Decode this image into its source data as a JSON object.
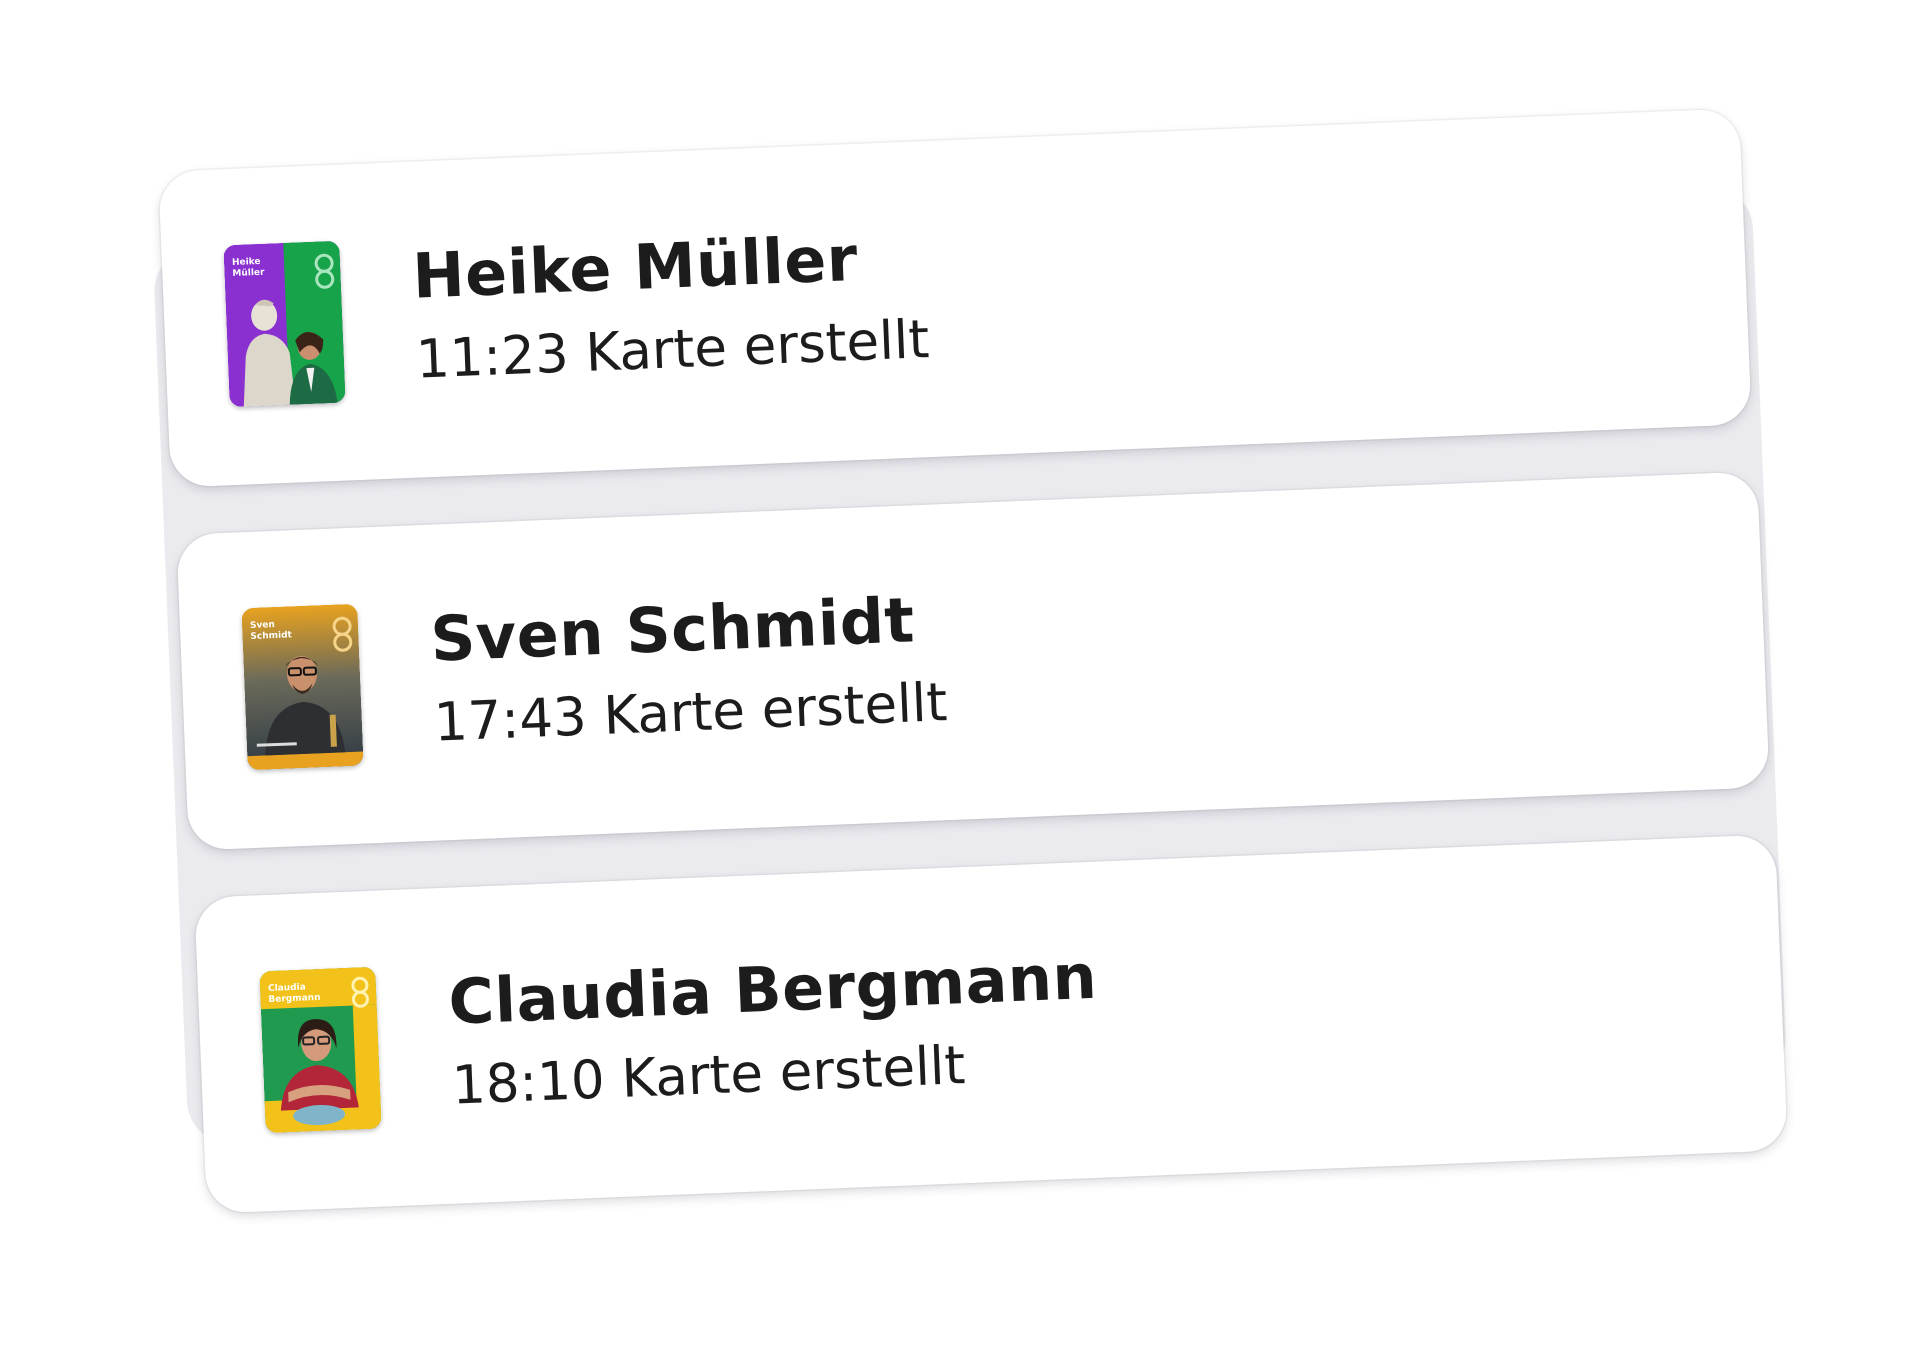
{
  "activity_feed": {
    "cards": [
      {
        "name": "Heike Müller",
        "status": "11:23 Karte erstellt",
        "thumbnail": {
          "colors": [
            "#8a2fd0",
            "#17a34a"
          ],
          "label_line1": "Heike",
          "label_line2": "Müller"
        }
      },
      {
        "name": "Sven Schmidt",
        "status": "17:43 Karte erstellt",
        "thumbnail": {
          "colors": [
            "#e8a21f",
            "#3a4650"
          ],
          "label_line1": "Sven",
          "label_line2": "Schmidt"
        }
      },
      {
        "name": "Claudia Bergmann",
        "status": "18:10 Karte erstellt",
        "thumbnail": {
          "colors": [
            "#f2c21a",
            "#1f9a4e"
          ],
          "label_line1": "Claudia",
          "label_line2": "Bergmann"
        }
      }
    ]
  }
}
